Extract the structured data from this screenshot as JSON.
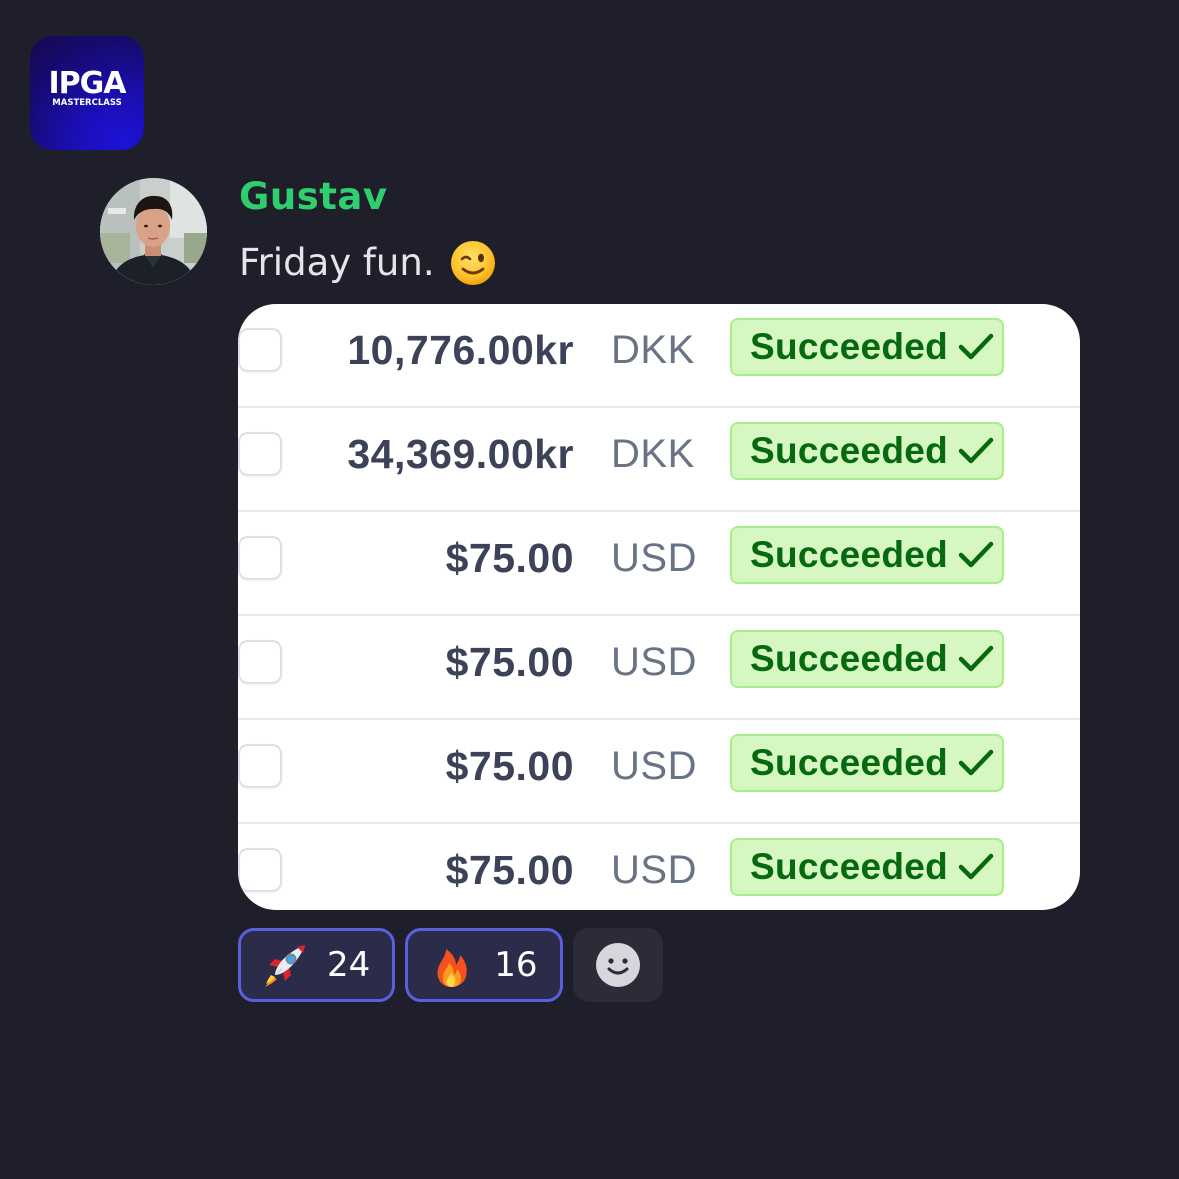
{
  "server": {
    "logo_title": "IPGA",
    "logo_subtitle": "MASTERCLASS"
  },
  "message": {
    "author": "Gustav",
    "author_color": "#2fce6e",
    "text": "Friday fun.",
    "emoji": "winking-face"
  },
  "payments": {
    "rows": [
      {
        "amount": "10,776.00kr",
        "currency": "DKK",
        "status": "Succeeded"
      },
      {
        "amount": "34,369.00kr",
        "currency": "DKK",
        "status": "Succeeded"
      },
      {
        "amount": "$75.00",
        "currency": "USD",
        "status": "Succeeded"
      },
      {
        "amount": "$75.00",
        "currency": "USD",
        "status": "Succeeded"
      },
      {
        "amount": "$75.00",
        "currency": "USD",
        "status": "Succeeded"
      },
      {
        "amount": "$75.00",
        "currency": "USD",
        "status": "Succeeded"
      }
    ],
    "status_color": "#05690d",
    "status_bg": "#d7f7c2"
  },
  "reactions": [
    {
      "emoji": "rocket",
      "count": "24"
    },
    {
      "emoji": "fire",
      "count": "16"
    }
  ],
  "colors": {
    "background": "#1e1f2a",
    "reaction_border": "#5a5fe0"
  }
}
